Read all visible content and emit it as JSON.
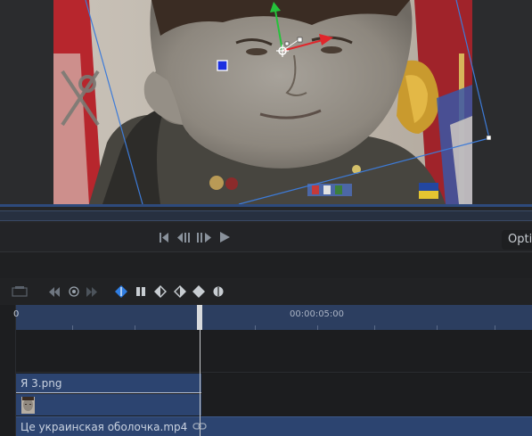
{
  "transport": {
    "options_label": "Opti",
    "buttons": [
      "go-to-start",
      "previous-frame",
      "next-frame",
      "play"
    ]
  },
  "keyframes": {
    "buttons": [
      "previous-keyframe",
      "add-remove-keyframe",
      "next-keyframe",
      "linear-keyframe",
      "hold-keyframe",
      "ease-in-keyframe",
      "ease-out-keyframe",
      "ease-in-out-keyframe",
      "auto-keyframe"
    ]
  },
  "timeline": {
    "ruler_start": "0",
    "ruler_mark": "00:00:05:00",
    "clips": [
      {
        "label": "Я 3.png",
        "thumbnail": "face-thumbnail"
      },
      {
        "label": "Це украинская оболочка.mp4",
        "icon": "link-icon"
      }
    ]
  },
  "colors": {
    "accent_blue": "#3d7bd8",
    "clip_blue": "#2c4470",
    "gizmo_green": "#25c23b",
    "gizmo_red": "#e0262b",
    "anchor_blue": "#1a2ee0"
  }
}
